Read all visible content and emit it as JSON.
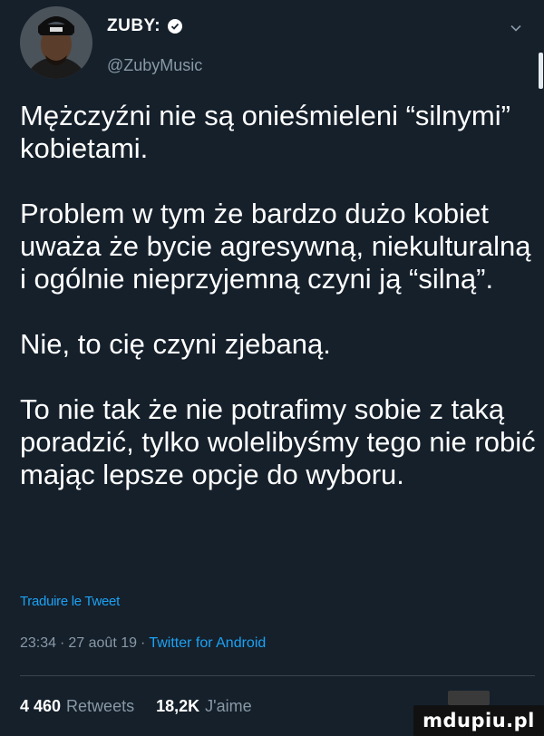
{
  "header": {
    "display_name": "ZUBY:",
    "handle": "@ZubyMusic",
    "icons": {
      "verified": "verified-badge-icon",
      "menu": "chevron-down-icon",
      "avatar": "profile-photo"
    }
  },
  "tweet": {
    "paragraphs": [
      "Mężczyźni nie są onieśmieleni “silnymi” kobietami.",
      "Problem w tym że bardzo dużo kobiet uważa że bycie agresywną, niekulturalną i ogólnie nieprzyjemną czyni ją “silną”.",
      "Nie, to cię czyni zjebaną.",
      "To nie tak że nie potrafimy sobie z taką poradzić, tylko wolelibyśmy tego nie robić mając lepsze opcje do wyboru."
    ],
    "translate_label": "Traduire le Tweet"
  },
  "meta": {
    "time": "23:34",
    "separator": "·",
    "date": "27 août 19",
    "source": "Twitter for Android"
  },
  "stats": {
    "retweets_count": "4 460",
    "retweets_label": "Retweets",
    "likes_count": "18,2K",
    "likes_label": "J'aime"
  },
  "watermark": {
    "text": "mdupiu.pl"
  },
  "colors": {
    "background": "#15202b",
    "text": "#ffffff",
    "secondary": "#8899a6",
    "link": "#1da1f2",
    "divider": "#38444d"
  }
}
